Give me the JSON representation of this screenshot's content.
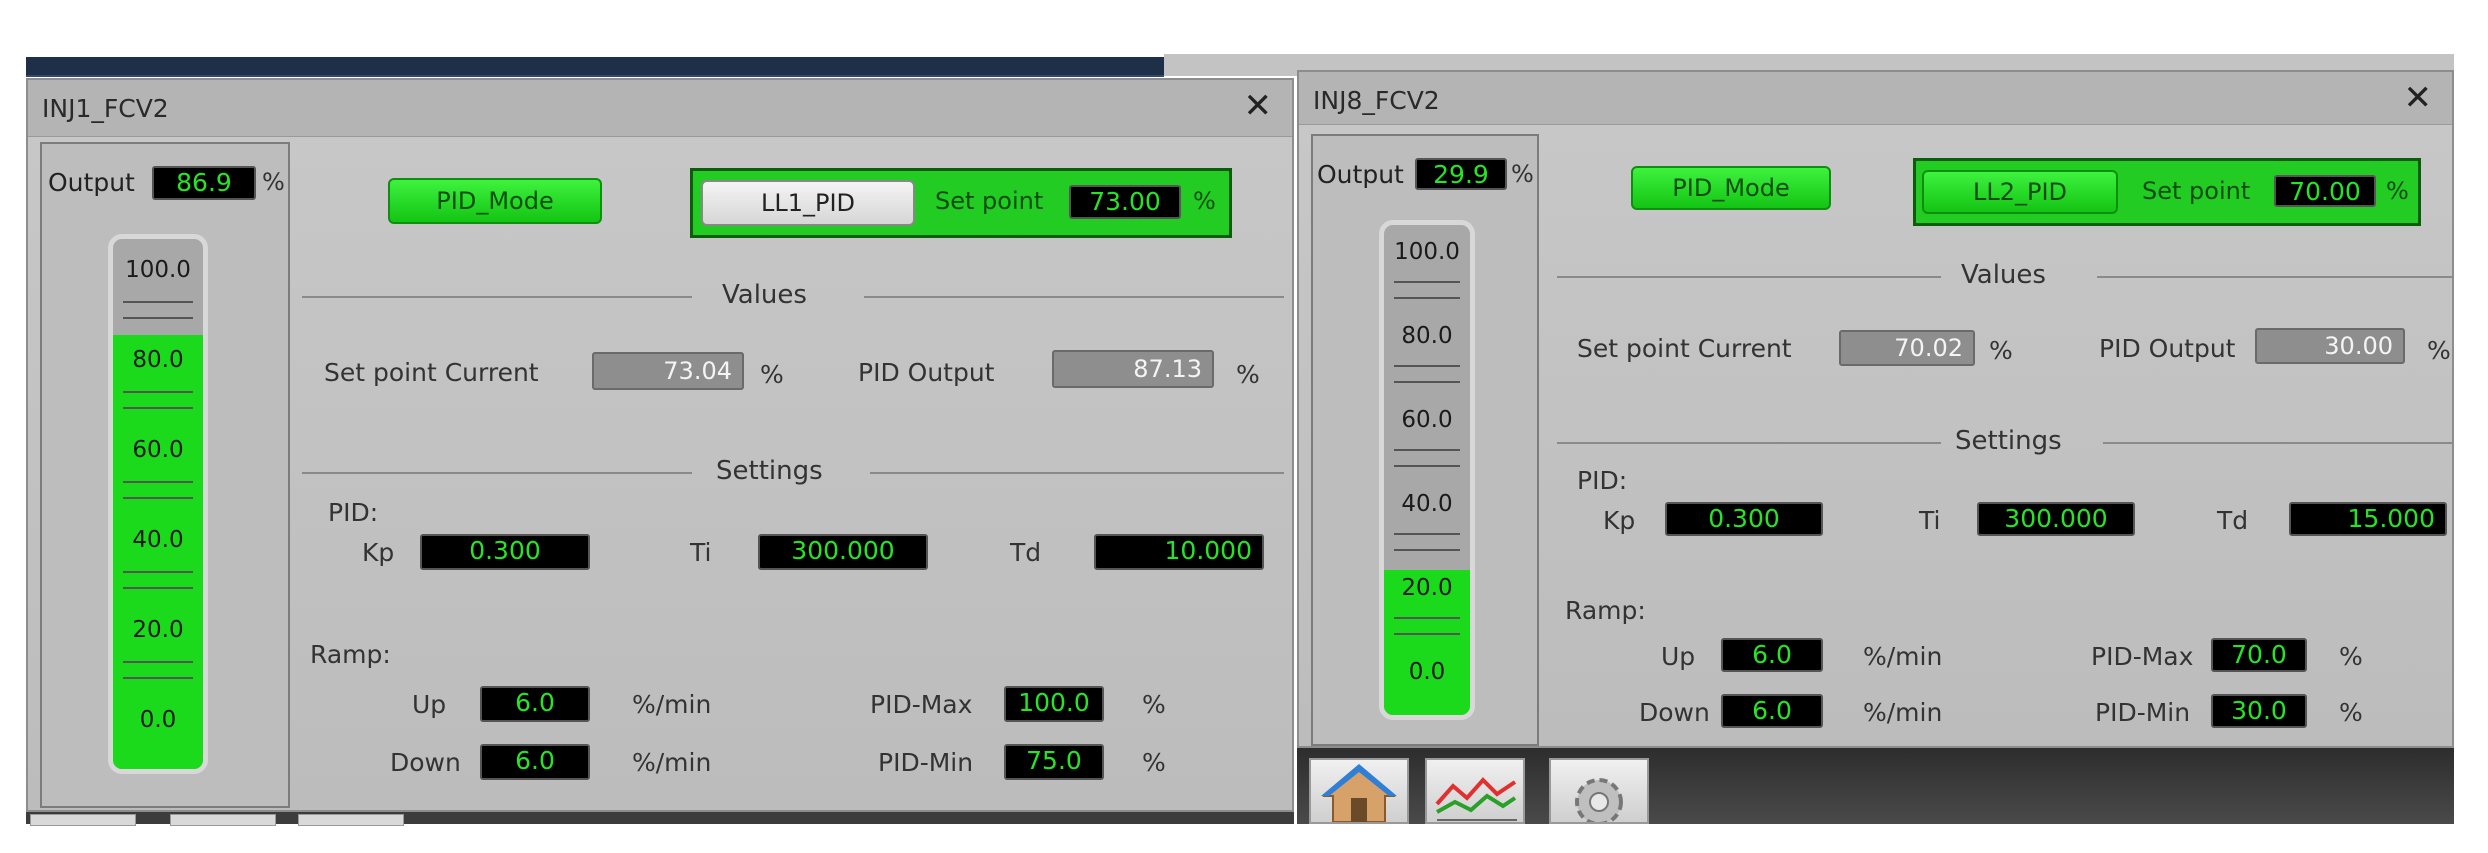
{
  "windows": [
    {
      "title": "INJ1_FCV2",
      "output": {
        "label": "Output",
        "value": "86.9",
        "unit": "%",
        "level": 86.9
      },
      "scale": [
        "100.0",
        "80.0",
        "60.0",
        "40.0",
        "20.0",
        "0.0"
      ],
      "mode_button": "PID_Mode",
      "controller_button": "LL1_PID",
      "setpoint": {
        "label": "Set point",
        "value": "73.00",
        "unit": "%"
      },
      "values_section": "Values",
      "sp_current": {
        "label": "Set point Current",
        "value": "73.04",
        "unit": "%"
      },
      "pid_output": {
        "label": "PID Output",
        "value": "87.13",
        "unit": "%"
      },
      "settings_section": "Settings",
      "pid_label": "PID:",
      "kp": {
        "label": "Kp",
        "value": "0.300"
      },
      "ti": {
        "label": "Ti",
        "value": "300.000"
      },
      "td": {
        "label": "Td",
        "value": "10.000"
      },
      "ramp_label": "Ramp:",
      "up": {
        "label": "Up",
        "value": "6.0",
        "unit": "%/min"
      },
      "down": {
        "label": "Down",
        "value": "6.0",
        "unit": "%/min"
      },
      "pid_max": {
        "label": "PID-Max",
        "value": "100.0",
        "unit": "%"
      },
      "pid_min": {
        "label": "PID-Min",
        "value": "75.0",
        "unit": "%"
      }
    },
    {
      "title": "INJ8_FCV2",
      "output": {
        "label": "Output",
        "value": "29.9",
        "unit": "%",
        "level": 29.9
      },
      "scale": [
        "100.0",
        "80.0",
        "60.0",
        "40.0",
        "20.0",
        "0.0"
      ],
      "mode_button": "PID_Mode",
      "controller_button": "LL2_PID",
      "setpoint": {
        "label": "Set point",
        "value": "70.00",
        "unit": "%"
      },
      "values_section": "Values",
      "sp_current": {
        "label": "Set point Current",
        "value": "70.02",
        "unit": "%"
      },
      "pid_output": {
        "label": "PID Output",
        "value": "30.00",
        "unit": "%"
      },
      "settings_section": "Settings",
      "pid_label": "PID:",
      "kp": {
        "label": "Kp",
        "value": "0.300"
      },
      "ti": {
        "label": "Ti",
        "value": "300.000"
      },
      "td": {
        "label": "Td",
        "value": "15.000"
      },
      "ramp_label": "Ramp:",
      "up": {
        "label": "Up",
        "value": "6.0",
        "unit": "%/min"
      },
      "down": {
        "label": "Down",
        "value": "6.0",
        "unit": "%/min"
      },
      "pid_max": {
        "label": "PID-Max",
        "value": "70.0",
        "unit": "%"
      },
      "pid_min": {
        "label": "PID-Min",
        "value": "30.0",
        "unit": "%"
      }
    }
  ],
  "toolbar_icons": [
    "home-icon",
    "trend-icon",
    "settings-gear-icon"
  ],
  "colors": {
    "lcd_green": "#26e426",
    "bar_green": "#1bd91b",
    "button_green": "#22cc22"
  }
}
